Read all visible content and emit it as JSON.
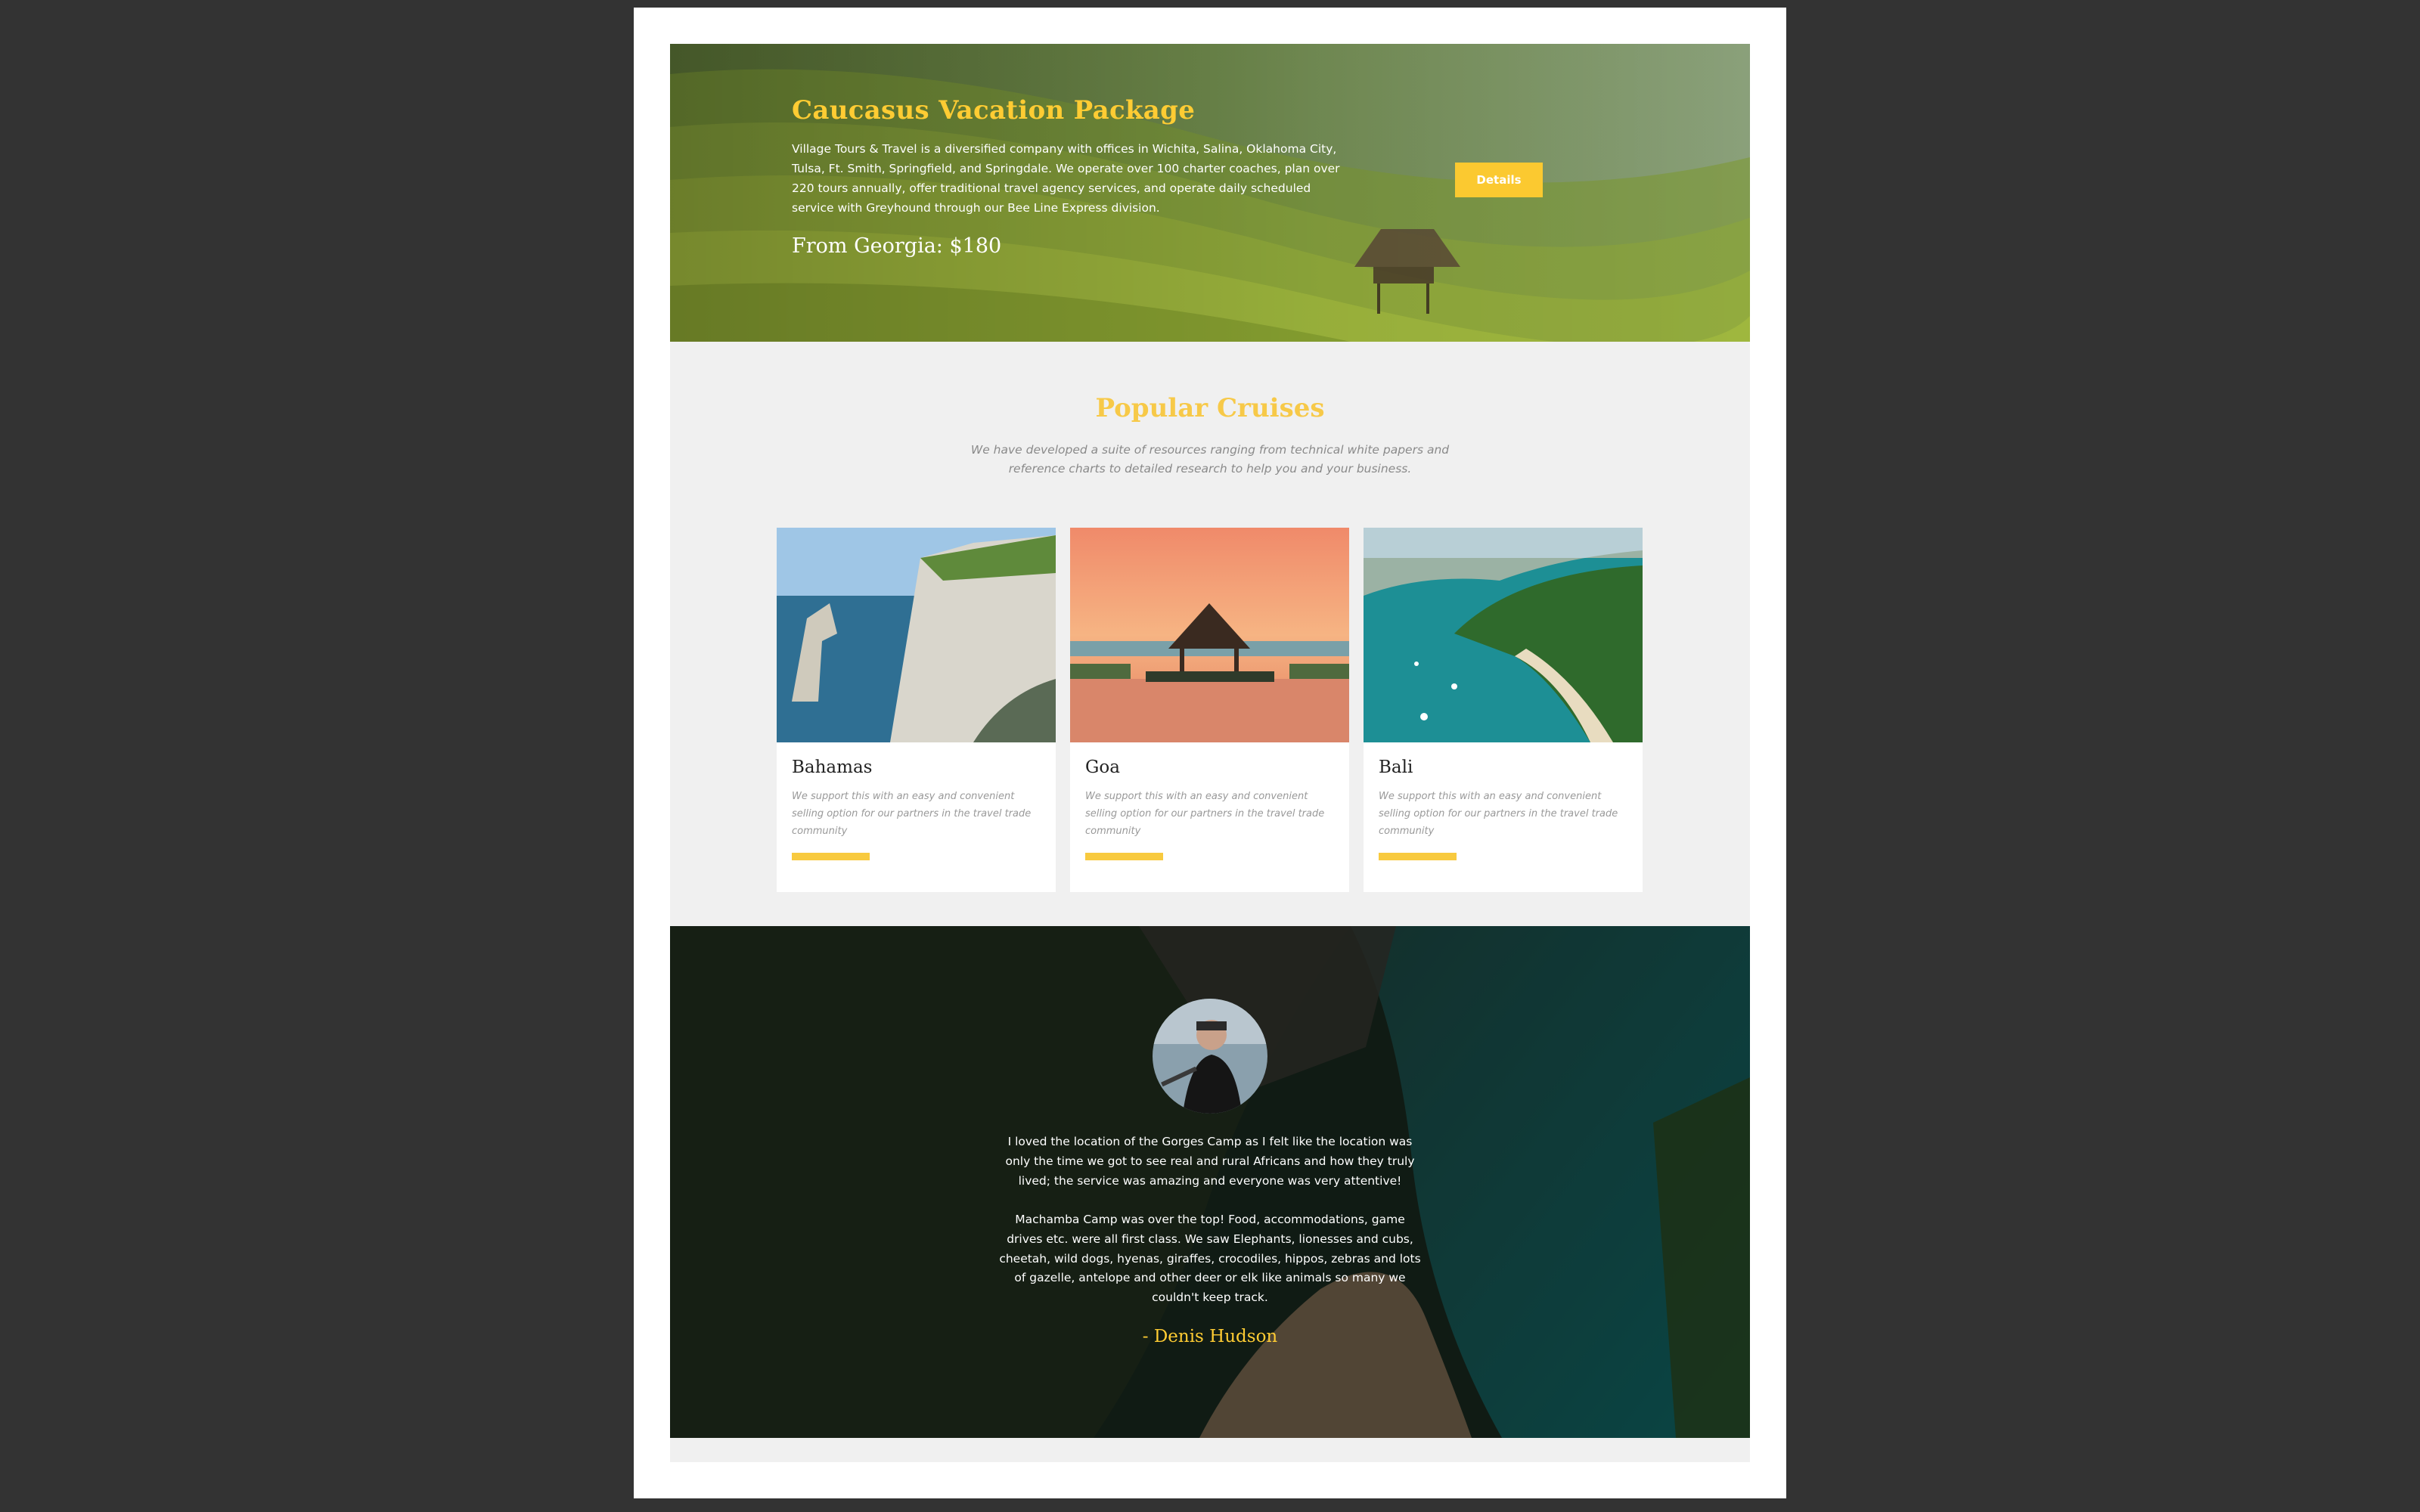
{
  "hero": {
    "title": "Caucasus Vacation Package",
    "description": "Village Tours & Travel is a diversified company with offices in Wichita, Salina, Oklahoma City, Tulsa, Ft. Smith, Springfield, and Springdale. We operate over 100 charter coaches, plan over 220 tours annually, offer traditional travel agency services, and operate daily scheduled service with Greyhound through our Bee Line Express division.",
    "price": "From Georgia: $180",
    "button_label": "Details"
  },
  "cruises": {
    "title": "Popular Cruises",
    "subtitle": "We have developed a suite of resources ranging from technical white papers and reference charts to detailed research to help you and your business.",
    "items": [
      {
        "name": "Bahamas",
        "description": "We support this with an easy and convenient selling option for our partners in the travel trade community"
      },
      {
        "name": "Goa",
        "description": "We support this with an easy and convenient selling option for our partners in the travel trade community"
      },
      {
        "name": "Bali",
        "description": "We support this with an easy and convenient selling option for our partners in the travel trade community"
      }
    ]
  },
  "testimonial": {
    "paragraph_1": "I loved the location of the Gorges Camp as I felt like the location was only the time we got to see real and rural Africans and how they truly lived; the service was amazing and everyone was very attentive!",
    "paragraph_2": "Machamba Camp was over the top! Food, accommodations, game drives etc. were all first class. We saw Elephants, lionesses and cubs, cheetah, wild dogs, hyenas, giraffes, crocodiles, hippos, zebras and lots of gazelle, antelope and other deer or elk like animals so many we couldn't keep track.",
    "author": "- Denis Hudson"
  },
  "colors": {
    "accent": "#fbc930",
    "page_background": "#333333",
    "section_background": "#f0f0f0"
  }
}
